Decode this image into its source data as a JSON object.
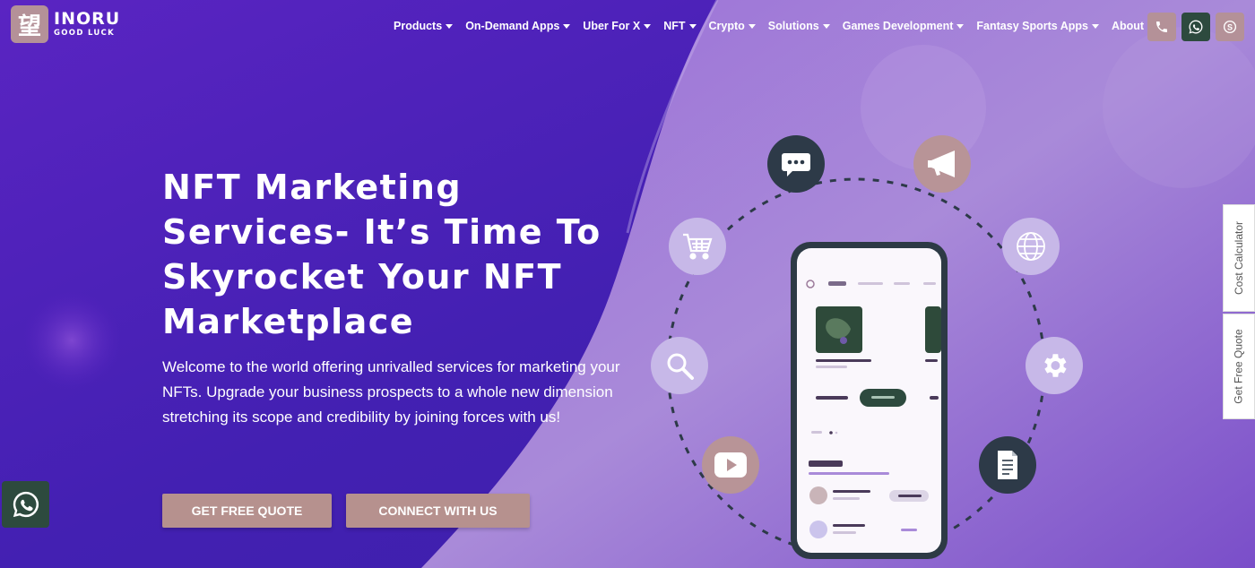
{
  "brand": {
    "logo_glyph": "望",
    "name": "INORU",
    "tagline": "GOOD LUCK"
  },
  "nav": {
    "items": [
      "Products",
      "On-Demand Apps",
      "Uber For X",
      "NFT",
      "Crypto",
      "Solutions",
      "Games Development",
      "Fantasy Sports Apps",
      "About Us"
    ]
  },
  "contact": {
    "icons": [
      "phone-icon",
      "whatsapp-icon",
      "skype-icon"
    ]
  },
  "hero": {
    "title": "NFT Marketing Services- It’s Time To Skyrocket Your NFT Marketplace",
    "description": "Welcome to the world offering unrivalled services for marketing your NFTs. Upgrade your business prospects to a whole new dimension stretching its scope and credibility by joining forces with us!",
    "cta_quote": "GET FREE QUOTE",
    "cta_connect": "CONNECT WITH US"
  },
  "side_tabs": {
    "calculator": "Cost Calculator",
    "quote": "Get Free Quote"
  },
  "orbit_icons": [
    "chat-icon",
    "megaphone-icon",
    "globe-icon",
    "gear-icon",
    "document-icon",
    "video-play-icon",
    "search-icon",
    "cart-icon"
  ],
  "colors": {
    "accent_rose": "#b6918e",
    "dark_slate": "#2d3a48",
    "whatsapp_bg": "#2d4a3e",
    "hero_purple": "#4a1fb0"
  }
}
